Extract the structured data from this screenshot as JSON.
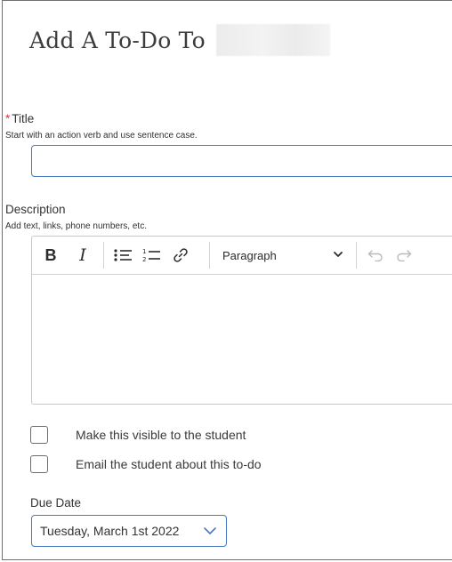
{
  "dialog": {
    "title": "Add A To-Do To"
  },
  "title_field": {
    "required_marker": "*",
    "label": "Title",
    "hint": "Start with an action verb and use sentence case.",
    "value": "",
    "placeholder": ""
  },
  "description_field": {
    "label": "Description",
    "hint": "Add text, links, phone numbers, etc.",
    "toolbar": {
      "bold": "B",
      "italic": "I",
      "bullet_list_icon": "bullet-list-icon",
      "numbered_list_icon": "numbered-list-icon",
      "link_icon": "link-icon",
      "block_format": "Paragraph",
      "undo_icon": "undo-icon",
      "redo_icon": "redo-icon"
    },
    "value": ""
  },
  "options": [
    {
      "label": "Make this visible to the student",
      "checked": false
    },
    {
      "label": "Email the student about this to-do",
      "checked": false
    }
  ],
  "due_date": {
    "label": "Due Date",
    "selected": "Tuesday, March 1st 2022"
  },
  "colors": {
    "accent_border": "#4a79c4",
    "required": "#d23c3c"
  }
}
